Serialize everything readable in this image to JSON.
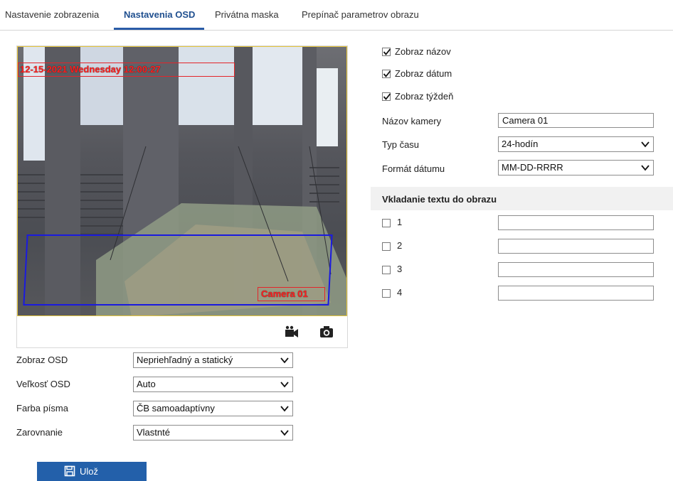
{
  "tabs": [
    {
      "label": "Nastavenie zobrazenia"
    },
    {
      "label": "Nastavenia OSD"
    },
    {
      "label": "Privátna maska"
    },
    {
      "label": "Prepínač parametrov obrazu"
    }
  ],
  "preview": {
    "osd_datetime": "12-15-2021 Wednesday 12:00:27",
    "osd_camera_name": "Camera 01",
    "record_icon": "video-record-icon",
    "capture_icon": "camera-capture-icon"
  },
  "left_form": {
    "osd_mode": {
      "label": "Zobraz OSD",
      "value": "Nepriehľadný a statický"
    },
    "osd_size": {
      "label": "Veľkosť OSD",
      "value": "Auto"
    },
    "font_color": {
      "label": "Farba písma",
      "value": "ČB samoadaptívny"
    },
    "alignment": {
      "label": "Zarovnanie",
      "value": "Vlastnté"
    }
  },
  "right_form": {
    "show_name": {
      "label": "Zobraz názov",
      "checked": true
    },
    "show_date": {
      "label": "Zobraz dátum",
      "checked": true
    },
    "show_week": {
      "label": "Zobraz týždeň",
      "checked": true
    },
    "camera_name": {
      "label": "Názov kamery",
      "value": "Camera 01"
    },
    "time_type": {
      "label": "Typ času",
      "value": "24-hodín"
    },
    "date_format": {
      "label": "Formát dátumu",
      "value": "MM-DD-RRRR"
    }
  },
  "text_overlay": {
    "title": "Vkladanie textu do obrazu",
    "items": [
      {
        "label": "1",
        "checked": false,
        "value": ""
      },
      {
        "label": "2",
        "checked": false,
        "value": ""
      },
      {
        "label": "3",
        "checked": false,
        "value": ""
      },
      {
        "label": "4",
        "checked": false,
        "value": ""
      }
    ]
  },
  "save_button": {
    "label": "Ulož",
    "icon": "save-icon"
  },
  "colors": {
    "accent": "#2360aa",
    "osd_text": "#ff2020",
    "mask": "#1a1adf",
    "frame": "#e5c53c"
  }
}
